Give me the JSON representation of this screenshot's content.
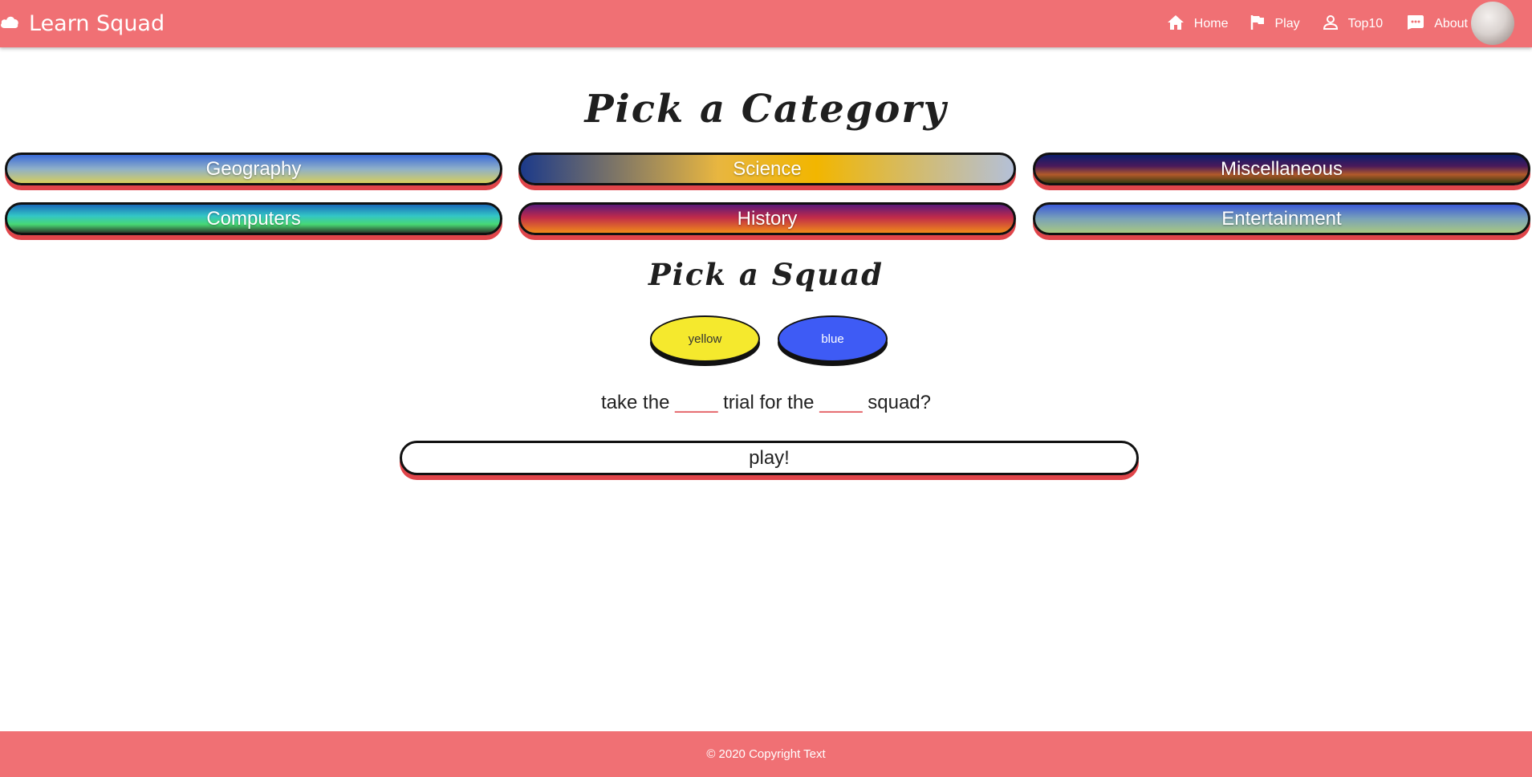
{
  "app": {
    "brand": "Learn Squad"
  },
  "nav": {
    "home": "Home",
    "play": "Play",
    "top10": "Top10",
    "about": "About"
  },
  "headings": {
    "category": "Pick a Category",
    "squad": "Pick a Squad"
  },
  "categories": [
    "Geography",
    "Science",
    "Miscellaneous",
    "Computers",
    "History",
    "Entertainment"
  ],
  "squads": {
    "yellow": "yellow",
    "blue": "blue"
  },
  "prompt": {
    "part1": "take the ",
    "blank1": "____",
    "part2": " trial for the ",
    "blank2": "____",
    "part3": " squad?"
  },
  "play_button": "play!",
  "footer": "© 2020 Copyright Text",
  "colors": {
    "brand": "#f07074",
    "accent_shadow": "#e0454a",
    "squad_yellow": "#f5e92d",
    "squad_blue": "#3e5bf5"
  },
  "icons": {
    "brand": "cloud-icon",
    "home": "home-icon",
    "play": "flag-icon",
    "top10": "person-icon",
    "about": "chat-icon"
  }
}
